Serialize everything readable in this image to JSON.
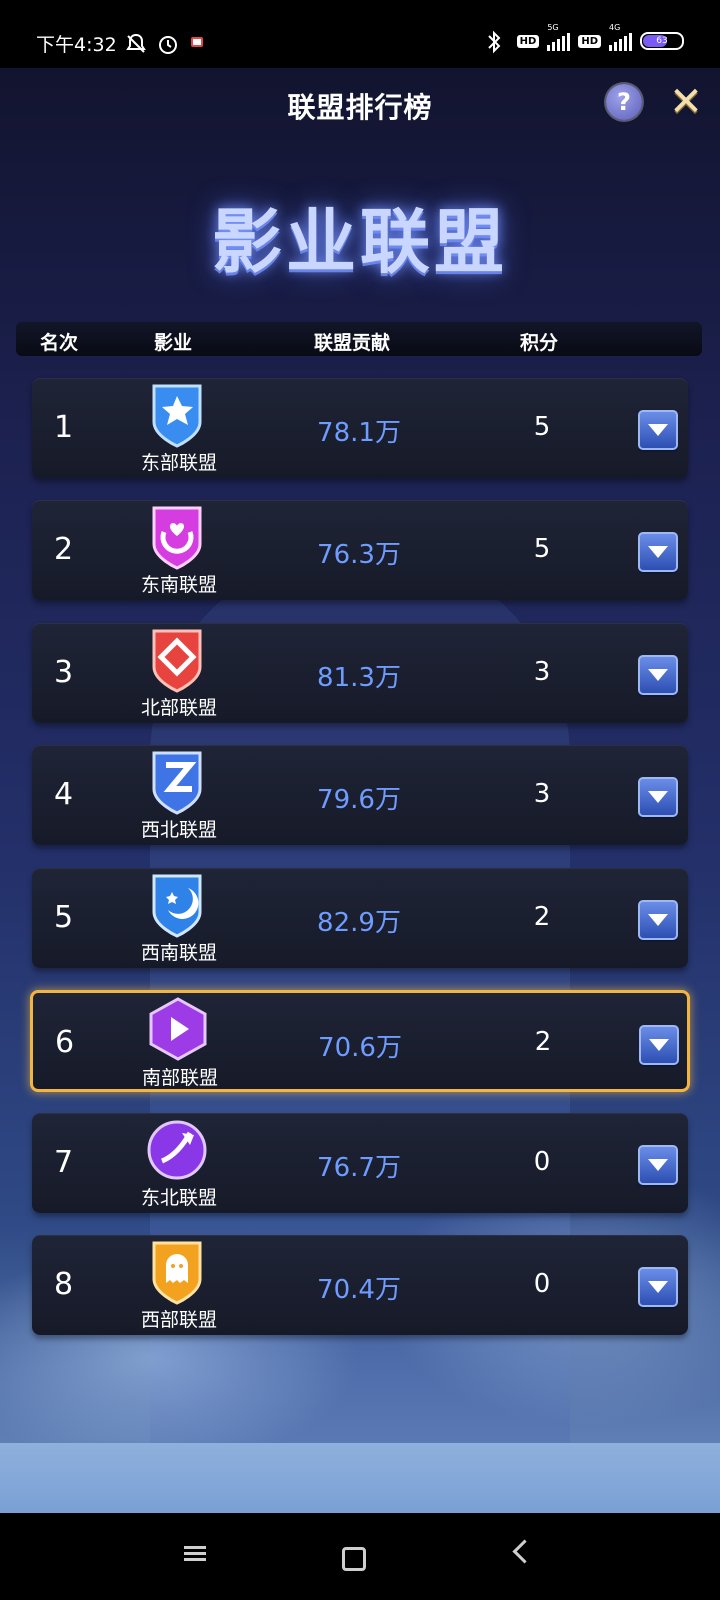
{
  "status_bar": {
    "time": "下午4:32",
    "hd1": "HD",
    "net1": "5G",
    "hd2": "HD",
    "net2": "4G",
    "battery": "63"
  },
  "header": {
    "title": "联盟排行榜",
    "help_label": "?",
    "close_label": "✕"
  },
  "banner_title": "影业联盟",
  "columns": {
    "rank": "名次",
    "studio": "影业",
    "contribution": "联盟贡献",
    "score": "积分"
  },
  "rows": [
    {
      "rank": "1",
      "name": "东部联盟",
      "contribution": "78.1万",
      "score": "5",
      "badge_icon": "star-shield-icon",
      "color": "#3a8df0"
    },
    {
      "rank": "2",
      "name": "东南联盟",
      "contribution": "76.3万",
      "score": "5",
      "badge_icon": "heart-moon-shield-icon",
      "color": "#d63de0"
    },
    {
      "rank": "3",
      "name": "北部联盟",
      "contribution": "81.3万",
      "score": "3",
      "badge_icon": "diamond-shield-icon",
      "color": "#e8443f"
    },
    {
      "rank": "4",
      "name": "西北联盟",
      "contribution": "79.6万",
      "score": "3",
      "badge_icon": "z-shield-icon",
      "color": "#3e74e6"
    },
    {
      "rank": "5",
      "name": "西南联盟",
      "contribution": "82.9万",
      "score": "2",
      "badge_icon": "moon-star-shield-icon",
      "color": "#2f82e8"
    },
    {
      "rank": "6",
      "name": "南部联盟",
      "contribution": "70.6万",
      "score": "2",
      "badge_icon": "play-hexagon-icon",
      "color": "#9d3be6",
      "highlighted": true
    },
    {
      "rank": "7",
      "name": "东北联盟",
      "contribution": "76.7万",
      "score": "0",
      "badge_icon": "comet-circle-icon",
      "color": "#8a37e8"
    },
    {
      "rank": "8",
      "name": "西部联盟",
      "contribution": "70.4万",
      "score": "0",
      "badge_icon": "ghost-shield-icon",
      "color": "#f2a21e"
    }
  ]
}
